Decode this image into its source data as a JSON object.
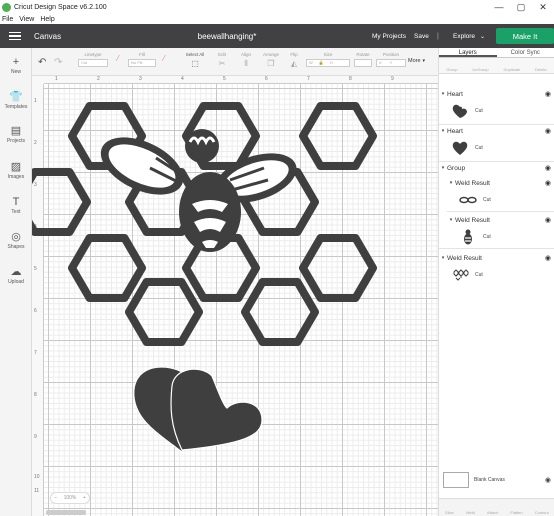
{
  "window": {
    "title": "Cricut Design Space  v6.2.100",
    "controls": [
      "—",
      "▢",
      "✕"
    ]
  },
  "menu": [
    "File",
    "View",
    "Help"
  ],
  "header": {
    "canvas_label": "Canvas",
    "project_name": "beewallhanging*",
    "my_projects": "My Projects",
    "save": "Save",
    "separator": "|",
    "explore": "Explore",
    "make_it": "Make It",
    "accent_color": "#1aa167"
  },
  "left_tools": [
    {
      "icon": "plus-icon",
      "label": "New"
    },
    {
      "icon": "shirt-icon",
      "label": "Templates"
    },
    {
      "icon": "projects-icon",
      "label": "Projects"
    },
    {
      "icon": "image-icon",
      "label": "Images"
    },
    {
      "icon": "text-icon",
      "label": "Text"
    },
    {
      "icon": "shapes-icon",
      "label": "Shapes"
    },
    {
      "icon": "upload-icon",
      "label": "Upload"
    }
  ],
  "toolbar": {
    "undo": "↶",
    "redo": "↷",
    "linetype_label": "Linetype",
    "linetype_value": "Cut",
    "fill_label": "Fill",
    "fill_value": "No Fill",
    "select_all": "Select All",
    "edit": "Edit",
    "align": "Align",
    "arrange": "Arrange",
    "flip": "Flip",
    "size": "Size",
    "rotate": "Rotate",
    "position": "Position",
    "w_label": "W",
    "h_label": "H",
    "x_label": "X",
    "y_label": "Y",
    "more": "More"
  },
  "rulers": {
    "top": [
      "1",
      "2",
      "3",
      "4",
      "5",
      "6",
      "7",
      "8",
      "9"
    ],
    "left": [
      "1",
      "2",
      "3",
      "4",
      "5",
      "6",
      "7",
      "8",
      "9",
      "10",
      "11"
    ]
  },
  "zoom": {
    "minus": "−",
    "value": "100%",
    "plus": "+"
  },
  "panel": {
    "tabs": [
      "Layers",
      "Color Sync"
    ],
    "actions": [
      "Group",
      "UnGroup",
      "Duplicate",
      "Delete"
    ],
    "layers": [
      {
        "name": "Heart",
        "sub": "Cut"
      },
      {
        "name": "Heart",
        "sub": "Cut"
      },
      {
        "name": "Group"
      },
      {
        "name": "Weld Result",
        "sub": "Cut"
      },
      {
        "name": "Weld Result",
        "sub": "Cut"
      },
      {
        "name": "Weld Result",
        "sub": "Cut"
      }
    ],
    "blank_canvas": "Blank Canvas",
    "bottom_actions": [
      "Slice",
      "Weld",
      "Attach",
      "Flatten",
      "Contour"
    ]
  },
  "colors": {
    "header_bg": "#414042",
    "shape_fill": "#3f3f3f"
  }
}
